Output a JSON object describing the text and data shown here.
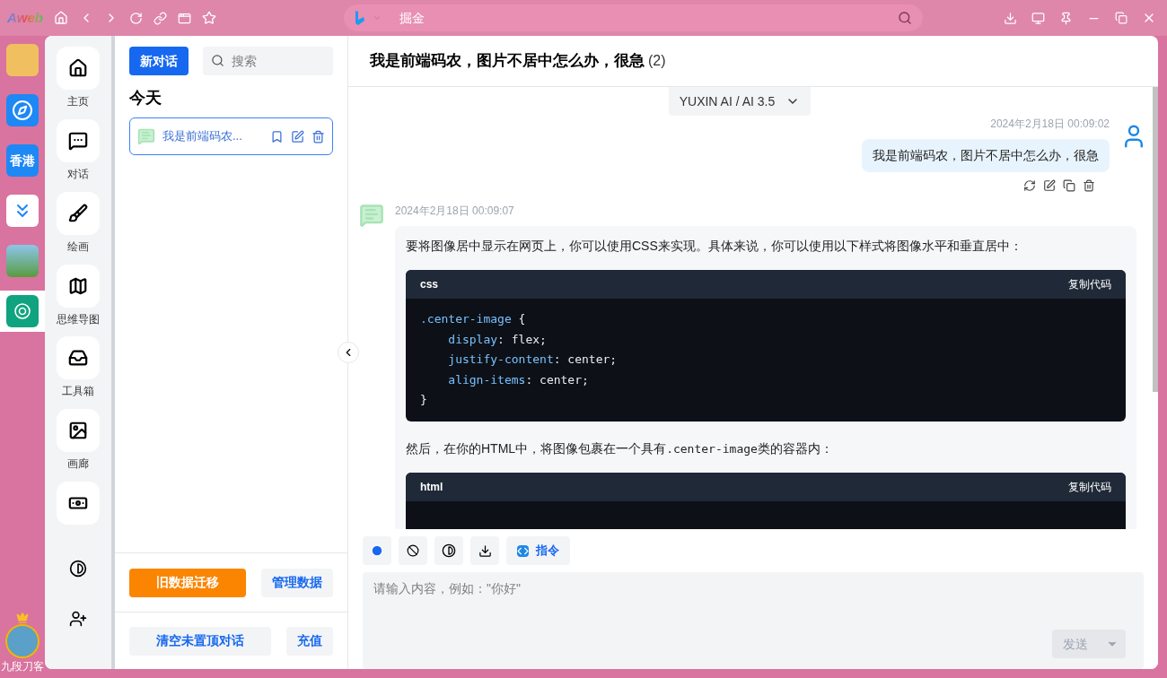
{
  "browser": {
    "logo": "Aweb",
    "address": "掘金"
  },
  "browser_sidebar": {
    "apps": [
      {
        "kind": "photo",
        "selected": false
      },
      {
        "kind": "compass",
        "selected": false
      },
      {
        "kind": "text",
        "label": "香港",
        "selected": false
      },
      {
        "kind": "stack",
        "selected": false
      },
      {
        "kind": "landscape",
        "selected": false
      },
      {
        "kind": "ai",
        "selected": true
      }
    ],
    "user": "九段刀客"
  },
  "nav": {
    "items": [
      {
        "kind": "home",
        "label": "主页"
      },
      {
        "kind": "chat",
        "label": "对话"
      },
      {
        "kind": "brush",
        "label": "绘画"
      },
      {
        "kind": "map",
        "label": "思维导图"
      },
      {
        "kind": "inbox",
        "label": "工具箱"
      },
      {
        "kind": "image",
        "label": "画廊"
      },
      {
        "kind": "money"
      }
    ]
  },
  "conversations": {
    "new_button": "新对话",
    "search_placeholder": "搜索",
    "group": "今天",
    "items": [
      {
        "title": "我是前端码农...",
        "selected": true
      }
    ],
    "buttons": [
      "旧数据迁移",
      "管理数据"
    ],
    "footer_buttons": [
      "清空未置顶对话",
      "充值"
    ]
  },
  "chat": {
    "title": "我是前端码农，图片不居中怎么办，很急",
    "count": "(2)",
    "model": "YUXIN AI / AI 3.5",
    "messages": [
      {
        "kind": "user",
        "time": "2024年2月18日 00:09:02",
        "text": "我是前端码农，图片不居中怎么办，很急"
      },
      {
        "kind": "assistant",
        "time": "2024年2月18日 00:09:07",
        "blocks": [
          {
            "kind": "text",
            "parts": [
              {
                "text": "要将图像居中显示在网页上，你可以使用CSS来实现。具体来说，你可以使用以下样式将图像水平和垂直居中：",
                "code": false
              }
            ]
          },
          {
            "kind": "code",
            "lang": "css",
            "copy": "复制代码",
            "lines": [
              {
                "key": ".center-image",
                "rest": " {"
              },
              {
                "key": "    display",
                "rest": ": flex;"
              },
              {
                "key": "    justify-content",
                "rest": ": center;"
              },
              {
                "key": "    align-items",
                "rest": ": center;"
              },
              {
                "rest": "}"
              }
            ]
          },
          {
            "kind": "text",
            "parts": [
              {
                "text": "然后，在你的HTML中，将图像包裹在一个具有",
                "code": false
              },
              {
                "text": ".center-image",
                "code": true
              },
              {
                "text": "类的容器内：",
                "code": false
              }
            ]
          },
          {
            "kind": "code",
            "lang": "html",
            "copy": "复制代码"
          }
        ]
      }
    ]
  },
  "composer": {
    "command_button": "指令",
    "placeholder": "请输入内容，例如：\"你好\"",
    "send": "发送",
    "send_disabled": true
  }
}
